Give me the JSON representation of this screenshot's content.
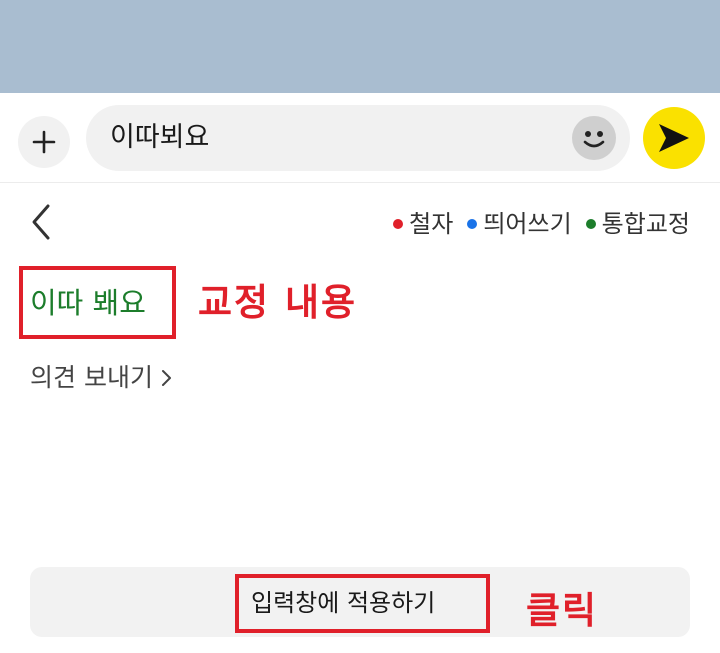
{
  "input_bar": {
    "message_text": "이따뵈요"
  },
  "legend": [
    {
      "label": "철자",
      "color": "#e0202a"
    },
    {
      "label": "띄어쓰기",
      "color": "#1a73e8"
    },
    {
      "label": "통합교정",
      "color": "#1c7d2b"
    }
  ],
  "correction": {
    "text": "이따 봬요",
    "color": "#1c7d2b"
  },
  "annotations": {
    "content_label": "교정 내용",
    "click_label": "클릭"
  },
  "feedback": {
    "label": "의견 보내기"
  },
  "apply_button": {
    "label": "입력창에 적용하기"
  },
  "colors": {
    "top_band": "#a9bdd0",
    "send_button": "#fae100",
    "annotation_red": "#e0202a"
  },
  "icons": [
    "plus-icon",
    "emoji-icon",
    "send-icon",
    "back-chevron-icon",
    "chevron-right-icon"
  ]
}
